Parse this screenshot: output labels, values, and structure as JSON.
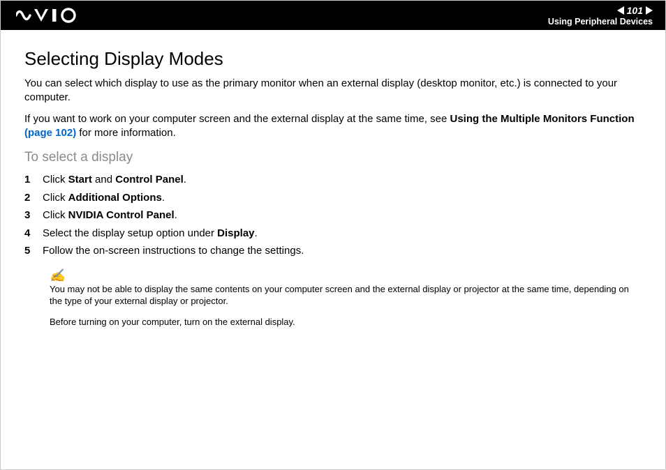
{
  "header": {
    "page_number": "101",
    "section": "Using Peripheral Devices"
  },
  "page": {
    "title": "Selecting Display Modes",
    "intro1": "You can select which display to use as the primary monitor when an external display (desktop monitor, etc.) is connected to your computer.",
    "intro2a": "If you want to work on your computer screen and the external display at the same time, see ",
    "intro2b_bold": "Using the Multiple Monitors Function ",
    "intro2c_link": "(page 102)",
    "intro2d": " for more information.",
    "subheading": "To select a display",
    "steps": [
      {
        "n": "1",
        "pre": "Click ",
        "bold1": "Start",
        "mid": " and ",
        "bold2": "Control Panel",
        "post": "."
      },
      {
        "n": "2",
        "pre": "Click ",
        "bold1": "Additional Options",
        "mid": "",
        "bold2": "",
        "post": "."
      },
      {
        "n": "3",
        "pre": "Click ",
        "bold1": "NVIDIA Control Panel",
        "mid": "",
        "bold2": "",
        "post": "."
      },
      {
        "n": "4",
        "pre": "Select the display setup option under ",
        "bold1": "Display",
        "mid": "",
        "bold2": "",
        "post": "."
      },
      {
        "n": "5",
        "pre": "Follow the on-screen instructions to change the settings.",
        "bold1": "",
        "mid": "",
        "bold2": "",
        "post": ""
      }
    ],
    "note1": "You may not be able to display the same contents on your computer screen and the external display or projector at the same time, depending on the type of your external display or projector.",
    "note2": "Before turning on your computer, turn on the external display."
  }
}
